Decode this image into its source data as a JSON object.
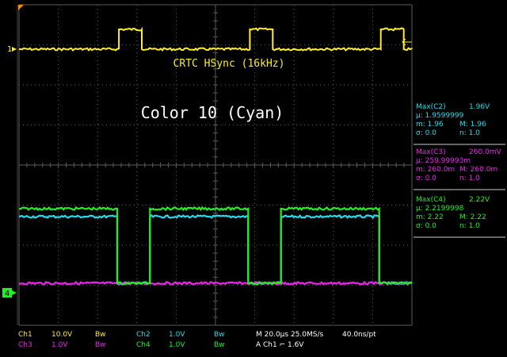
{
  "chart_data": {
    "type": "line",
    "instrument": "oscilloscope",
    "x": [
      0.0,
      0.8,
      3.3,
      4.0,
      7.2,
      8.0,
      10.5,
      11.2
    ],
    "xunit": "div",
    "xlim": [
      0,
      12
    ],
    "series": [
      {
        "name": "CRTC HSync (16kHz)",
        "channel": "Ch1",
        "color": "#ffee22",
        "levels": [
          "low",
          "high"
        ],
        "segments": [
          [
            0,
            3.05,
            "low"
          ],
          [
            3.05,
            3.75,
            "high"
          ],
          [
            3.75,
            7.05,
            "low"
          ],
          [
            7.05,
            7.75,
            "high"
          ],
          [
            7.75,
            11.05,
            "low"
          ],
          [
            11.05,
            11.75,
            "high"
          ],
          [
            11.75,
            12,
            "low"
          ]
        ]
      },
      {
        "name": "Ch2",
        "channel": "Ch2",
        "color": "#22ddee",
        "segments": [
          [
            0,
            3.0,
            "high"
          ],
          [
            3.0,
            4.0,
            "low"
          ],
          [
            4.0,
            7.0,
            "high"
          ],
          [
            7.0,
            8.0,
            "low"
          ],
          [
            8.0,
            11.0,
            "high"
          ],
          [
            11.0,
            12,
            "low"
          ]
        ]
      },
      {
        "name": "Ch3",
        "channel": "Ch3",
        "color": "#ee22ee",
        "segments": [
          [
            0,
            12,
            "low"
          ]
        ]
      },
      {
        "name": "Ch4",
        "channel": "Ch4",
        "color": "#22ee22",
        "segments": [
          [
            0,
            3.0,
            "high"
          ],
          [
            3.0,
            4.0,
            "low"
          ],
          [
            4.0,
            7.0,
            "high"
          ],
          [
            7.0,
            8.0,
            "low"
          ],
          [
            8.0,
            11.0,
            "high"
          ],
          [
            11.0,
            12,
            "low"
          ]
        ]
      }
    ],
    "annotations": {
      "signal_label": "CRTC HSync (16kHz)",
      "color_label": "Color 10 (Cyan)"
    },
    "grid": true
  },
  "markers": {
    "ch1": "1",
    "ch4": "4"
  },
  "measurements": [
    {
      "color": "#22ddee",
      "title": "Max(C2)",
      "value": "1.96V",
      "mean": "μ: 1.9599999",
      "min": "m: 1.96",
      "max": "M: 1.96",
      "sigma": "σ: 0.0",
      "n": "n: 1.0"
    },
    {
      "color": "#ee22ee",
      "title": "Max(C3)",
      "value": "260.0mV",
      "mean": "μ: 259.99993m",
      "min": "m: 260.0m",
      "max": "M: 260.0m",
      "sigma": "σ: 0.0",
      "n": "n: 1.0"
    },
    {
      "color": "#22ee22",
      "title": "Max(C4)",
      "value": "2.22V",
      "mean": "μ: 2.2199998",
      "min": "m: 2.22",
      "max": "M: 2.22",
      "sigma": "σ: 0.0",
      "n": "n: 1.0"
    }
  ],
  "status": {
    "ch1": "Ch1",
    "ch1_scale": "10.0V",
    "ch1_bw": "Bw",
    "ch2": "Ch2",
    "ch2_scale": "1.0V",
    "ch2_bw": "Bw",
    "ch3": "Ch3",
    "ch3_scale": "1.0V",
    "ch3_bw": "Bw",
    "ch4": "Ch4",
    "ch4_scale": "1.0V",
    "ch4_bw": "Bw",
    "timebase": "M 20.0µs 25.0MS/s",
    "resolution": "40.0ns/pt",
    "trigger": "A  Ch1  ⌐  1.6V"
  },
  "colors": {
    "ch1": "#ffee22",
    "ch2": "#22ddee",
    "ch3": "#ee22ee",
    "ch4": "#22ee22",
    "trigger_marker": "#ff8800",
    "grid": "#5a5a5a"
  }
}
